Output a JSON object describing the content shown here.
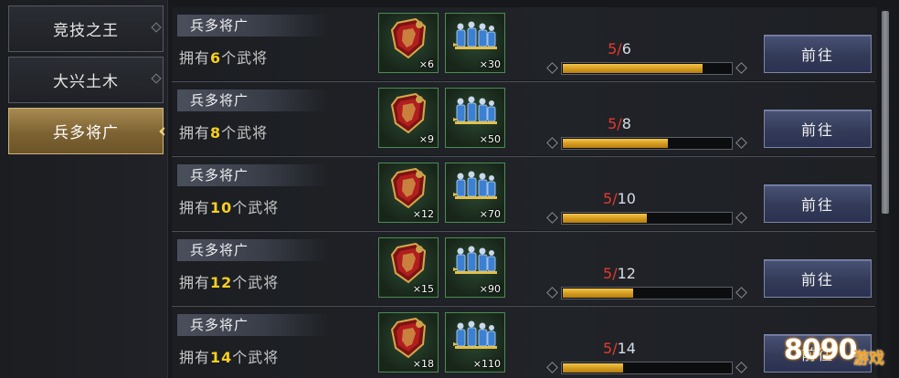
{
  "tabs": [
    {
      "label": "竞技之王",
      "active": false
    },
    {
      "label": "大兴土木",
      "active": false
    },
    {
      "label": "兵多将广",
      "active": true
    }
  ],
  "rows": [
    {
      "title": "兵多将广",
      "desc_prefix": "拥有",
      "count": "6",
      "desc_suffix": "个武将",
      "reward1_qty": "×6",
      "reward2_qty": "×30",
      "progress_current": "5",
      "progress_sep": "/",
      "progress_total": "6",
      "progress_fraction": 0.833,
      "button_label": "前往"
    },
    {
      "title": "兵多将广",
      "desc_prefix": "拥有",
      "count": "8",
      "desc_suffix": "个武将",
      "reward1_qty": "×9",
      "reward2_qty": "×50",
      "progress_current": "5",
      "progress_sep": "/",
      "progress_total": "8",
      "progress_fraction": 0.625,
      "button_label": "前往"
    },
    {
      "title": "兵多将广",
      "desc_prefix": "拥有",
      "count": "10",
      "desc_suffix": "个武将",
      "reward1_qty": "×12",
      "reward2_qty": "×70",
      "progress_current": "5",
      "progress_sep": "/",
      "progress_total": "10",
      "progress_fraction": 0.5,
      "button_label": "前往"
    },
    {
      "title": "兵多将广",
      "desc_prefix": "拥有",
      "count": "12",
      "desc_suffix": "个武将",
      "reward1_qty": "×15",
      "reward2_qty": "×90",
      "progress_current": "5",
      "progress_sep": "/",
      "progress_total": "12",
      "progress_fraction": 0.417,
      "button_label": "前往"
    },
    {
      "title": "兵多将广",
      "desc_prefix": "拥有",
      "count": "14",
      "desc_suffix": "个武将",
      "reward1_qty": "×18",
      "reward2_qty": "×110",
      "progress_current": "5",
      "progress_sep": "/",
      "progress_total": "14",
      "progress_fraction": 0.357,
      "button_label": "前往"
    }
  ],
  "icons": {
    "reward1": "shield-icon",
    "reward2": "soldiers-icon"
  },
  "colors": {
    "count_highlight": "#f6d020",
    "progress_current": "#e33a2e",
    "bar_fill": "#d49a1e",
    "active_tab": "#8c7040",
    "button": "#3a4162"
  },
  "watermark": {
    "number": "8090",
    "text": "游戏"
  }
}
